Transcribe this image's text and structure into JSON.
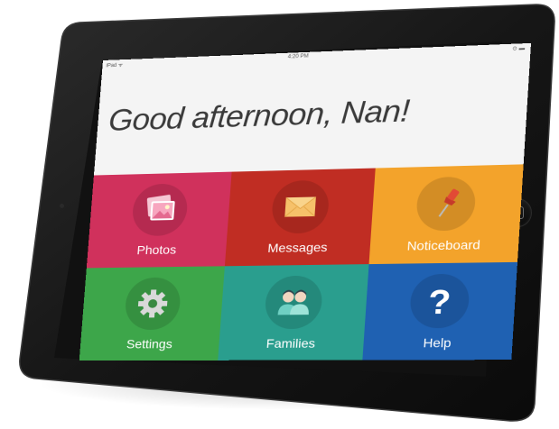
{
  "status_bar": {
    "carrier": "iPad ᯤ",
    "time": "4:20 PM",
    "battery": "⊙ ▬"
  },
  "greeting": "Good afternoon, Nan!",
  "tiles": [
    {
      "label": "Photos",
      "icon": "photos-icon",
      "color": "#d0315c"
    },
    {
      "label": "Messages",
      "icon": "envelope-icon",
      "color": "#c02d23"
    },
    {
      "label": "Noticeboard",
      "icon": "pushpin-icon",
      "color": "#f3a32b"
    },
    {
      "label": "Settings",
      "icon": "gear-icon",
      "color": "#3da64a"
    },
    {
      "label": "Families",
      "icon": "people-icon",
      "color": "#2a9e8e"
    },
    {
      "label": "Help",
      "icon": "question-mark-icon",
      "color": "#1f61b2"
    }
  ]
}
